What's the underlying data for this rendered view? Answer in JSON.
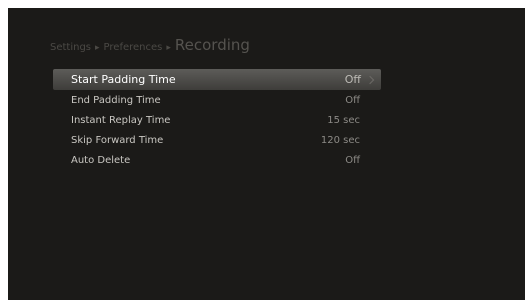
{
  "breadcrumb": {
    "level1": "Settings",
    "separator": "▸",
    "level2": "Preferences",
    "current": "Recording"
  },
  "menu": {
    "items": [
      {
        "label": "Start Padding Time",
        "value": "Off",
        "icon": "chevron-right-icon"
      },
      {
        "label": "End Padding Time",
        "value": "Off"
      },
      {
        "label": "Instant Replay Time",
        "value": "15 sec"
      },
      {
        "label": "Skip Forward Time",
        "value": "120 sec"
      },
      {
        "label": "Auto Delete",
        "value": "Off"
      }
    ]
  },
  "colors": {
    "background": "#1b1a18",
    "highlight": "#4f4e4b",
    "text": "#c9c7c2",
    "muted": "#8c8a86"
  }
}
